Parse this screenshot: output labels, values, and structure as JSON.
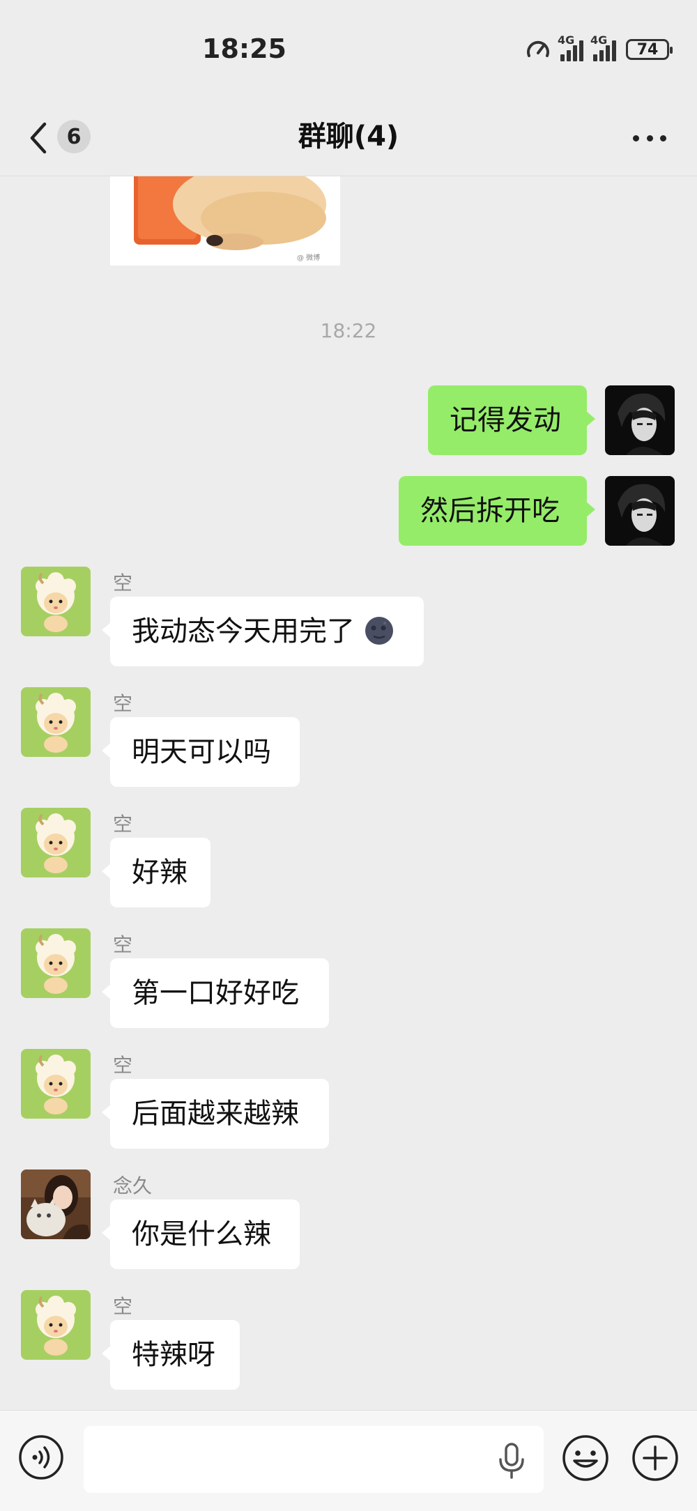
{
  "status": {
    "time": "18:25",
    "network_1": "4G",
    "network_2": "4G",
    "battery": "74"
  },
  "nav": {
    "unread_count": "6",
    "title": "群聊(4)"
  },
  "chat": {
    "timestamp": "18:22",
    "messages": [
      {
        "direction": "out",
        "text": "记得发动"
      },
      {
        "direction": "out",
        "text": "然后拆开吃"
      },
      {
        "direction": "in",
        "sender": "空",
        "text": "我动态今天用完了",
        "emoji": "new-moon-face-icon"
      },
      {
        "direction": "in",
        "sender": "空",
        "text": "明天可以吗"
      },
      {
        "direction": "in",
        "sender": "空",
        "text": "好辣"
      },
      {
        "direction": "in",
        "sender": "空",
        "text": "第一口好好吃"
      },
      {
        "direction": "in",
        "sender": "空",
        "text": "后面越来越辣"
      },
      {
        "direction": "in",
        "sender": "念久",
        "text": "你是什么辣"
      },
      {
        "direction": "in",
        "sender": "空",
        "text": "特辣呀"
      }
    ]
  },
  "input": {
    "placeholder": ""
  },
  "colors": {
    "background": "#ededed",
    "outgoing_bubble": "#95ec69",
    "incoming_bubble": "#ffffff",
    "sender_name": "#8a8a8a",
    "timestamp": "#a8a8a8"
  },
  "icons": [
    "back-icon",
    "more-icon",
    "voice-icon",
    "microphone-icon",
    "emoji-icon",
    "plus-icon",
    "signal-icon",
    "battery-icon",
    "network-speed-icon"
  ]
}
